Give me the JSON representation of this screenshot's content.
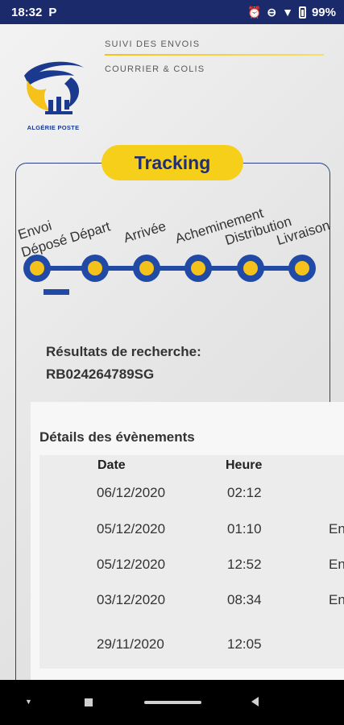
{
  "status_bar": {
    "time": "18:32",
    "battery": "99%",
    "icons": [
      "parking-icon",
      "alarm-icon",
      "dnd-icon",
      "wifi-icon",
      "battery-icon"
    ]
  },
  "header": {
    "line1": "SUIVI DES ENVOIS",
    "line2": "COURRIER & COLIS",
    "logo_text": "ALGÉRIE POSTE"
  },
  "tracking": {
    "title": "Tracking",
    "steps": [
      "Envoi",
      "Déposé Départ",
      "Arrivée",
      "Acheminement",
      "Distribution",
      "Livraison"
    ],
    "current_step_index": 0
  },
  "results": {
    "title": "Résultats de recherche:",
    "code": "RB024264789SG"
  },
  "details": {
    "title": "Détails des évènements",
    "columns": [
      "Date",
      "Heure"
    ],
    "rows": [
      {
        "date": "06/12/2020",
        "time": "02:12",
        "extra": ""
      },
      {
        "date": "05/12/2020",
        "time": "01:10",
        "extra": "En"
      },
      {
        "date": "05/12/2020",
        "time": "12:52",
        "extra": "En"
      },
      {
        "date": "03/12/2020",
        "time": "08:34",
        "extra": "En"
      },
      {
        "date": "29/11/2020",
        "time": "12:05",
        "extra": ""
      }
    ]
  },
  "colors": {
    "primary_blue": "#214aa6",
    "accent_yellow": "#f6cf1a",
    "dark_navy": "#1e2e78"
  }
}
